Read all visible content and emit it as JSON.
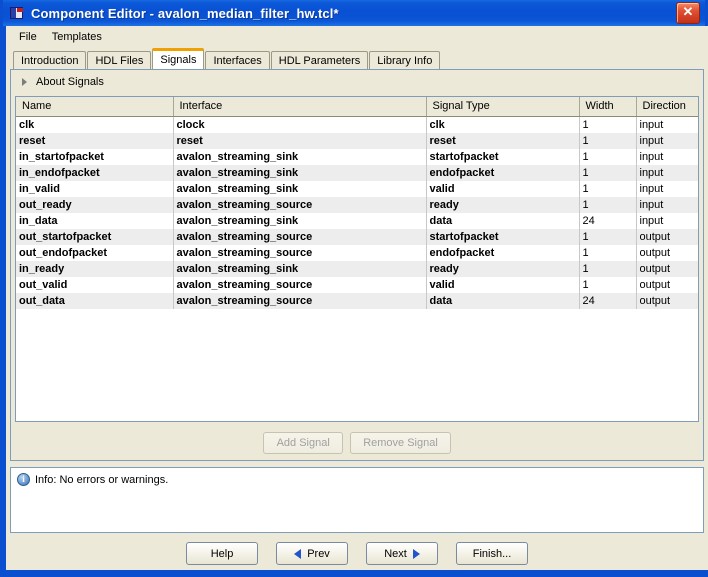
{
  "window": {
    "title": "Component Editor - avalon_median_filter_hw.tcl*",
    "icon": "component-editor-icon",
    "close_label": "✕"
  },
  "menubar": {
    "items": [
      {
        "label": "File"
      },
      {
        "label": "Templates"
      }
    ]
  },
  "tabs": [
    {
      "label": "Introduction",
      "active": false
    },
    {
      "label": "HDL Files",
      "active": false
    },
    {
      "label": "Signals",
      "active": true
    },
    {
      "label": "Interfaces",
      "active": false
    },
    {
      "label": "HDL Parameters",
      "active": false
    },
    {
      "label": "Library Info",
      "active": false
    }
  ],
  "about": {
    "label": "About Signals",
    "expanded": false
  },
  "table": {
    "columns": [
      "Name",
      "Interface",
      "Signal Type",
      "Width",
      "Direction"
    ],
    "rows": [
      {
        "name": "clk",
        "interface": "clock",
        "signal_type": "clk",
        "width": "1",
        "direction": "input"
      },
      {
        "name": "reset",
        "interface": "reset",
        "signal_type": "reset",
        "width": "1",
        "direction": "input"
      },
      {
        "name": "in_startofpacket",
        "interface": "avalon_streaming_sink",
        "signal_type": "startofpacket",
        "width": "1",
        "direction": "input"
      },
      {
        "name": "in_endofpacket",
        "interface": "avalon_streaming_sink",
        "signal_type": "endofpacket",
        "width": "1",
        "direction": "input"
      },
      {
        "name": "in_valid",
        "interface": "avalon_streaming_sink",
        "signal_type": "valid",
        "width": "1",
        "direction": "input"
      },
      {
        "name": "out_ready",
        "interface": "avalon_streaming_source",
        "signal_type": "ready",
        "width": "1",
        "direction": "input"
      },
      {
        "name": "in_data",
        "interface": "avalon_streaming_sink",
        "signal_type": "data",
        "width": "24",
        "direction": "input"
      },
      {
        "name": "out_startofpacket",
        "interface": "avalon_streaming_source",
        "signal_type": "startofpacket",
        "width": "1",
        "direction": "output"
      },
      {
        "name": "out_endofpacket",
        "interface": "avalon_streaming_source",
        "signal_type": "endofpacket",
        "width": "1",
        "direction": "output"
      },
      {
        "name": "in_ready",
        "interface": "avalon_streaming_sink",
        "signal_type": "ready",
        "width": "1",
        "direction": "output"
      },
      {
        "name": "out_valid",
        "interface": "avalon_streaming_source",
        "signal_type": "valid",
        "width": "1",
        "direction": "output"
      },
      {
        "name": "out_data",
        "interface": "avalon_streaming_source",
        "signal_type": "data",
        "width": "24",
        "direction": "output"
      }
    ]
  },
  "signal_buttons": {
    "add_label": "Add Signal",
    "remove_label": "Remove Signal",
    "add_enabled": false,
    "remove_enabled": false
  },
  "status": {
    "icon": "info-icon",
    "text": "Info: No errors or warnings."
  },
  "nav": {
    "help_label": "Help",
    "prev_label": "Prev",
    "next_label": "Next",
    "finish_label": "Finish..."
  },
  "colors": {
    "titlebar_blue": "#0a50d4",
    "window_border": "#0a4fd0",
    "panel_face": "#ece9d8",
    "active_tab_accent": "#f0a000",
    "row_alt": "#ededed",
    "arrow_blue": "#2255cc",
    "close_red": "#c3301a"
  }
}
